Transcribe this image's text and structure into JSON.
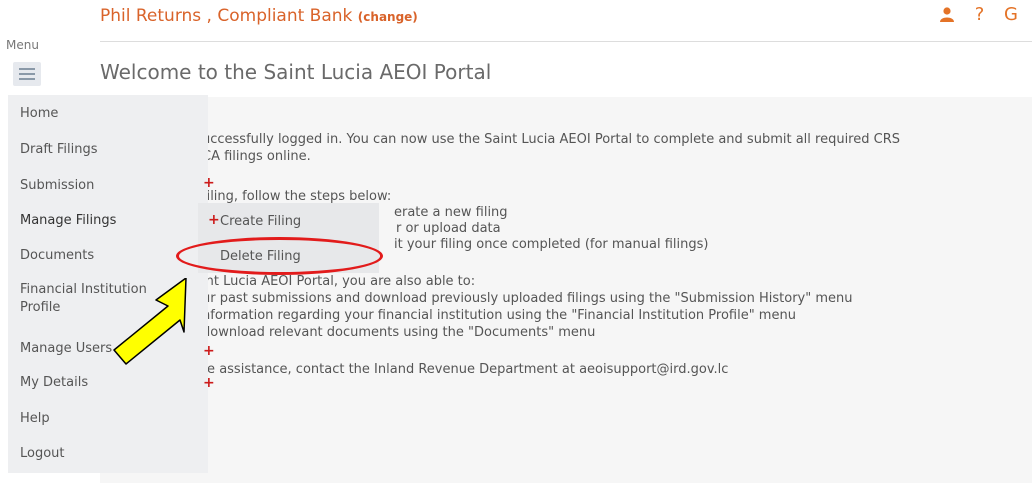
{
  "header": {
    "user_company": "Phil Returns , Compliant Bank",
    "change_link": "(change)",
    "icons": [
      "user-icon",
      "help-icon",
      "logout-icon"
    ]
  },
  "menu": {
    "label": "Menu",
    "items": [
      {
        "label": "Home"
      },
      {
        "label": "Draft Filings"
      },
      {
        "label": "Submission",
        "has_submenu": true
      },
      {
        "label": "Manage Filings",
        "has_submenu": true,
        "active": true
      },
      {
        "label": "Documents"
      },
      {
        "label": "Financial Institution"
      },
      {
        "label": "Profile"
      },
      {
        "label": "Manage Users",
        "has_submenu": true
      },
      {
        "label": "My Details",
        "has_submenu": true
      },
      {
        "label": "Help"
      },
      {
        "label": "Logout"
      }
    ]
  },
  "submenu": {
    "items": [
      {
        "label": "Create Filing"
      },
      {
        "label": "Delete Filing",
        "highlighted": true
      }
    ]
  },
  "main": {
    "title": "Welcome to the Saint Lucia AEOI Portal",
    "lines": [
      "uccessfully logged in. You can now use the Saint Lucia AEOI Portal to complete and submit all required CRS",
      "CA filings online.",
      "filing, follow the steps below:",
      "erate a new filing",
      "r or upload data",
      "it your filing once completed (for manual filings)",
      "int Lucia AEOI Portal, you are also able to:",
      "ur past submissions and download previously uploaded filings using the \"Submission History\" menu",
      "nformation regarding your financial institution using the \"Financial Institution Profile\" menu",
      "download relevant documents using the \"Documents\" menu",
      "re assistance, contact the Inland Revenue Department at aeoisupport@ird.gov.lc"
    ]
  },
  "colors": {
    "accent": "#e47327",
    "highlight_oval": "#e21b1b",
    "arrow_fill": "#ffff00",
    "plus": "#cc1b1b"
  }
}
